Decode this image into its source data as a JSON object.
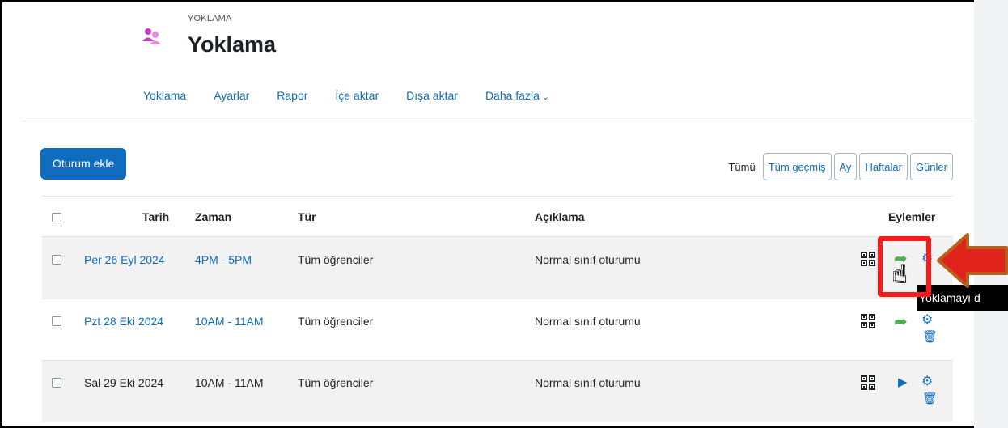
{
  "header": {
    "pretitle": "YOKLAMA",
    "title": "Yoklama",
    "icon": "people-icon",
    "icon_color": "#c23ac7"
  },
  "secondary_nav": {
    "items": [
      "Yoklama",
      "Ayarlar",
      "Rapor",
      "İçe aktar",
      "Dışa aktar"
    ],
    "more_label": "Daha fazla",
    "more_icon": "chevron-down-icon"
  },
  "toolbar": {
    "add_session_label": "Oturum ekle",
    "views_label": "Tümü",
    "view_buttons": [
      "Tüm geçmiş",
      "Ay",
      "Haftalar",
      "Günler"
    ]
  },
  "table": {
    "headers": {
      "date": "Tarih",
      "time": "Zaman",
      "type": "Tür",
      "description": "Açıklama",
      "actions": "Eylemler"
    },
    "rows": [
      {
        "date": "Per 26 Eyl 2024",
        "time": "4PM - 5PM",
        "type": "Tüm öğrenciler",
        "description": "Normal sınıf oturumu",
        "date_linked": true,
        "primary_action": "take-attendance-icon"
      },
      {
        "date": "Pzt 28 Eki 2024",
        "time": "10AM - 11AM",
        "type": "Tüm öğrenciler",
        "description": "Normal sınıf oturumu",
        "date_linked": true,
        "primary_action": "take-attendance-icon"
      },
      {
        "date": "Sal 29 Eki 2024",
        "time": "10AM - 11AM",
        "type": "Tüm öğrenciler",
        "description": "Normal sınıf oturumu",
        "date_linked": false,
        "primary_action": "play-icon"
      }
    ]
  },
  "tooltip": {
    "text": "Yoklamayı d"
  },
  "annotations": {
    "highlight_color": "#ff1a1a",
    "arrow_color": "#e0241b",
    "arrow_border_color": "#b8611f"
  },
  "colors": {
    "link": "#0f6cbf",
    "primary_button": "#0f6cbf",
    "take_attendance": "#4caf50"
  }
}
